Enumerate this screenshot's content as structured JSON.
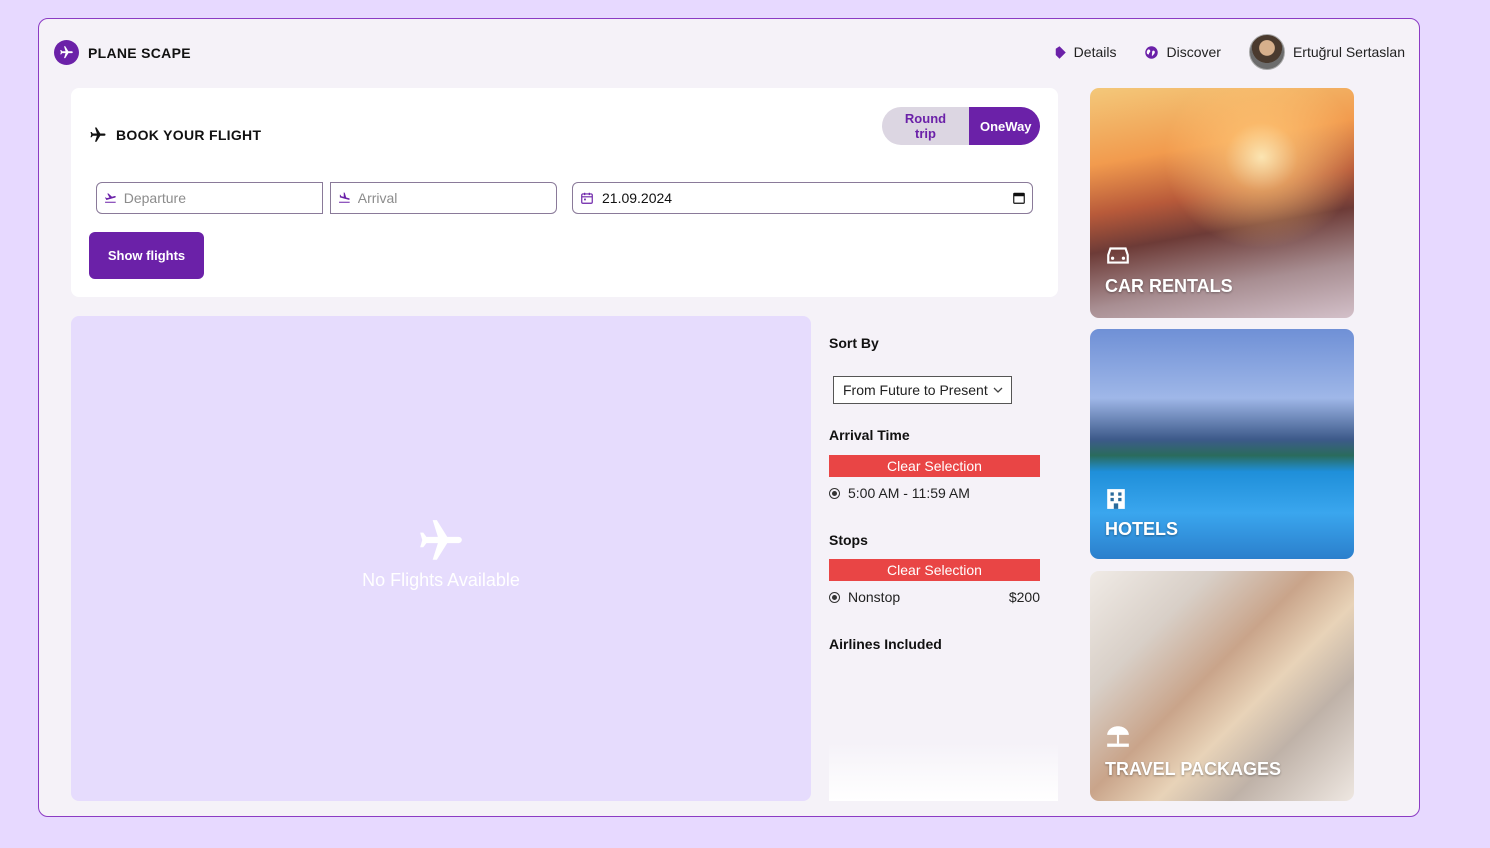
{
  "header": {
    "logo_text": "PLANE SCAPE",
    "nav": [
      {
        "label": "Details",
        "icon": "tag-icon"
      },
      {
        "label": "Discover",
        "icon": "globe-icon"
      }
    ],
    "user_name": "Ertuğrul Sertaslan"
  },
  "booking": {
    "title": "BOOK YOUR FLIGHT",
    "trip_types": {
      "round": "Round trip",
      "oneway": "OneWay",
      "selected": "OneWay"
    },
    "departure_placeholder": "Departure",
    "arrival_placeholder": "Arrival",
    "date_value": "21.09.2024",
    "show_button": "Show flights"
  },
  "results": {
    "empty_message": "No Flights Available"
  },
  "filters": {
    "sort_label": "Sort By",
    "sort_selected": "From Future to Present",
    "arrival_label": "Arrival Time",
    "arrival_clear": "Clear Selection",
    "arrival_option": "5:00 AM - 11:59 AM",
    "stops_label": "Stops",
    "stops_clear": "Clear Selection",
    "stops_option": "Nonstop",
    "stops_price": "$200",
    "airlines_label": "Airlines Included"
  },
  "promos": {
    "car": "CAR RENTALS",
    "hotels": "HOTELS",
    "travel": "TRAVEL PACKAGES"
  },
  "colors": {
    "accent": "#6b21a8",
    "page_bg": "#e7d9ff",
    "results_bg": "#e6dcfd",
    "danger": "#e94545"
  }
}
